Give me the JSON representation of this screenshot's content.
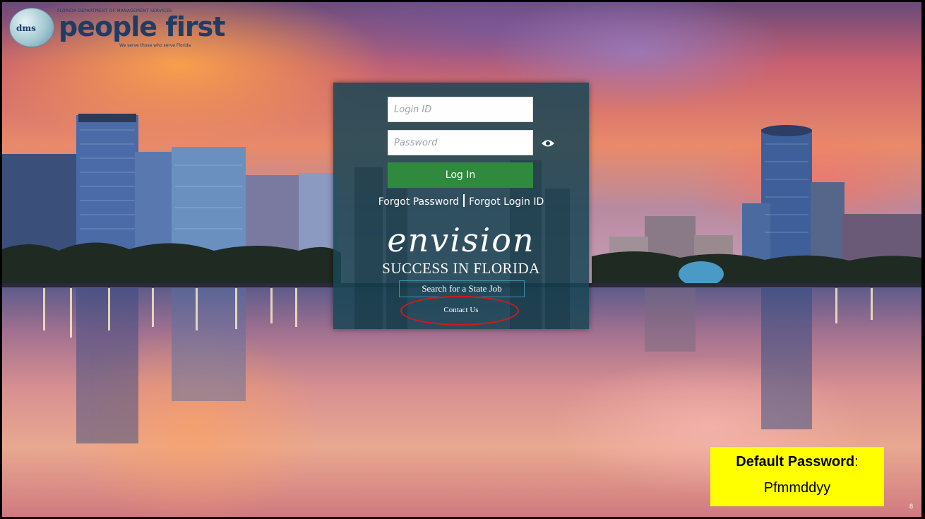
{
  "logo": {
    "badge_text": "dms",
    "department": "FLORIDA DEPARTMENT OF MANAGEMENT SERVICES",
    "name": "people first",
    "tagline": "We serve those who serve Florida"
  },
  "login": {
    "login_id_placeholder": "Login ID",
    "password_placeholder": "Password",
    "show_password_icon": "eye-icon",
    "login_button": "Log In",
    "forgot_password": "Forgot Password",
    "forgot_login_id": "Forgot Login ID"
  },
  "branding": {
    "envision": "envision",
    "slogan": "SUCCESS IN FLORIDA"
  },
  "links": {
    "search_job": "Search for a State Job",
    "contact_us": "Contact Us"
  },
  "callout": {
    "label": "Default Password",
    "value": "Pfmmddyy"
  },
  "slide_number": "8",
  "colors": {
    "panel": "#194655",
    "login_button": "#2f8a3e",
    "callout_bg": "#ffff00",
    "highlight": "#d21a1a"
  }
}
